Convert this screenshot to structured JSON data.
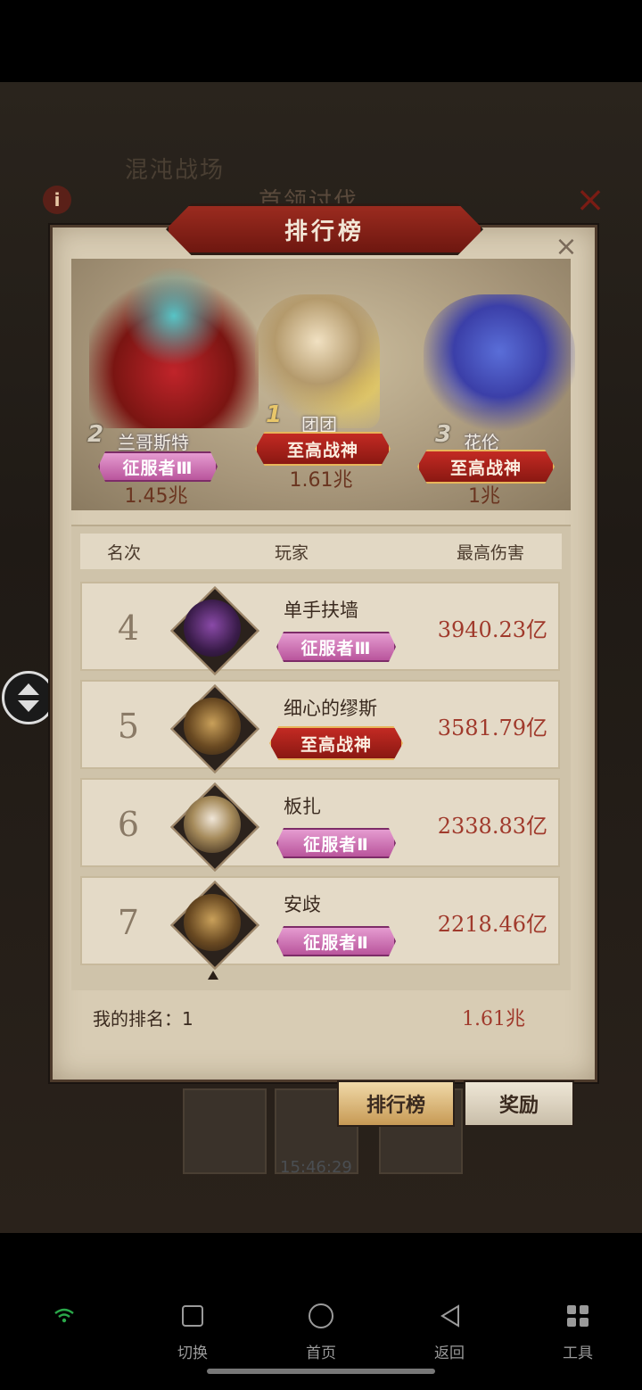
{
  "background": {
    "title": "混沌战场",
    "subtitle": "首领讨伐",
    "info_icon": "i",
    "timer": "15:46:29"
  },
  "modal": {
    "title": "排行榜",
    "close_icon": "×"
  },
  "podium": [
    {
      "rank": "1",
      "name": "团团",
      "badge": "至高战神",
      "badge_style": "red",
      "value": "1.61兆"
    },
    {
      "rank": "2",
      "name": "兰哥斯特",
      "badge": "征服者Ⅲ",
      "badge_style": "pink",
      "value": "1.45兆"
    },
    {
      "rank": "3",
      "name": "花伦",
      "badge": "至高战神",
      "badge_style": "red",
      "value": "1兆"
    }
  ],
  "table": {
    "headers": {
      "rank": "名次",
      "player": "玩家",
      "damage": "最高伤害"
    },
    "rows": [
      {
        "rank": "4",
        "name": "单手扶墙",
        "badge": "征服者Ⅲ",
        "badge_style": "pink",
        "damage": "3940.23亿"
      },
      {
        "rank": "5",
        "name": "细心的缪斯",
        "badge": "至高战神",
        "badge_style": "red",
        "damage": "3581.79亿"
      },
      {
        "rank": "6",
        "name": "板扎",
        "badge": "征服者Ⅱ",
        "badge_style": "pink",
        "damage": "2338.83亿"
      },
      {
        "rank": "7",
        "name": "安歧",
        "badge": "征服者Ⅱ",
        "badge_style": "pink",
        "damage": "2218.46亿"
      }
    ]
  },
  "my_rank": {
    "label": "我的排名：1",
    "value": "1.61兆"
  },
  "tabs": {
    "leaderboard": "排行榜",
    "rewards": "奖励"
  },
  "system_nav": [
    {
      "label": "切换",
      "icon": "square-icon"
    },
    {
      "label": "首页",
      "icon": "circle-icon"
    },
    {
      "label": "返回",
      "icon": "triangle-back-icon"
    },
    {
      "label": "工具",
      "icon": "grid-icon"
    }
  ],
  "colors": {
    "accent_red": "#a03a2c",
    "badge_pink": "#c766a8",
    "badge_red": "#a8201a",
    "parchment": "#d8ccb4"
  }
}
